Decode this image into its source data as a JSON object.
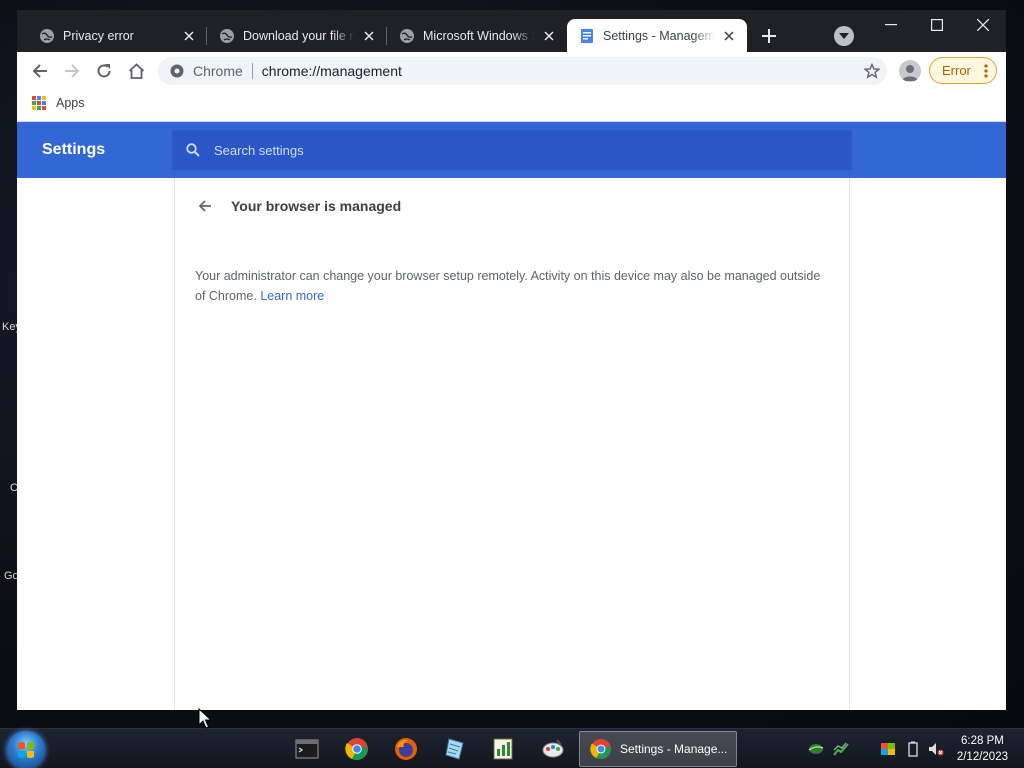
{
  "desktop": {
    "labels": [
      "Key",
      "C",
      "Go"
    ]
  },
  "browser": {
    "tabs": [
      {
        "title": "Privacy error",
        "icon": "globe-icon",
        "active": false
      },
      {
        "title": "Download your file now",
        "icon": "globe-icon",
        "active": false
      },
      {
        "title": "Microsoft Windows Server",
        "icon": "globe-icon",
        "active": false
      },
      {
        "title": "Settings - Management",
        "icon": "settings-doc-icon",
        "active": true
      }
    ],
    "omnibox": {
      "site_label": "Chrome",
      "url": "chrome://management"
    },
    "error_chip": "Error",
    "bookmarks": {
      "apps_label": "Apps"
    }
  },
  "settings": {
    "header_title": "Settings",
    "search_placeholder": "Search settings",
    "page_title": "Your browser is managed",
    "body_text": "Your administrator can change your browser setup remotely. Activity on this device may also be managed outside of Chrome.",
    "learn_more": "Learn more"
  },
  "taskbar": {
    "active_window_title": "Settings - Manage...",
    "time": "6:28 PM",
    "date": "2/12/2023"
  },
  "colors": {
    "settings_blue": "#3367d6",
    "tabstrip": "#202124",
    "link": "#3367d6"
  }
}
